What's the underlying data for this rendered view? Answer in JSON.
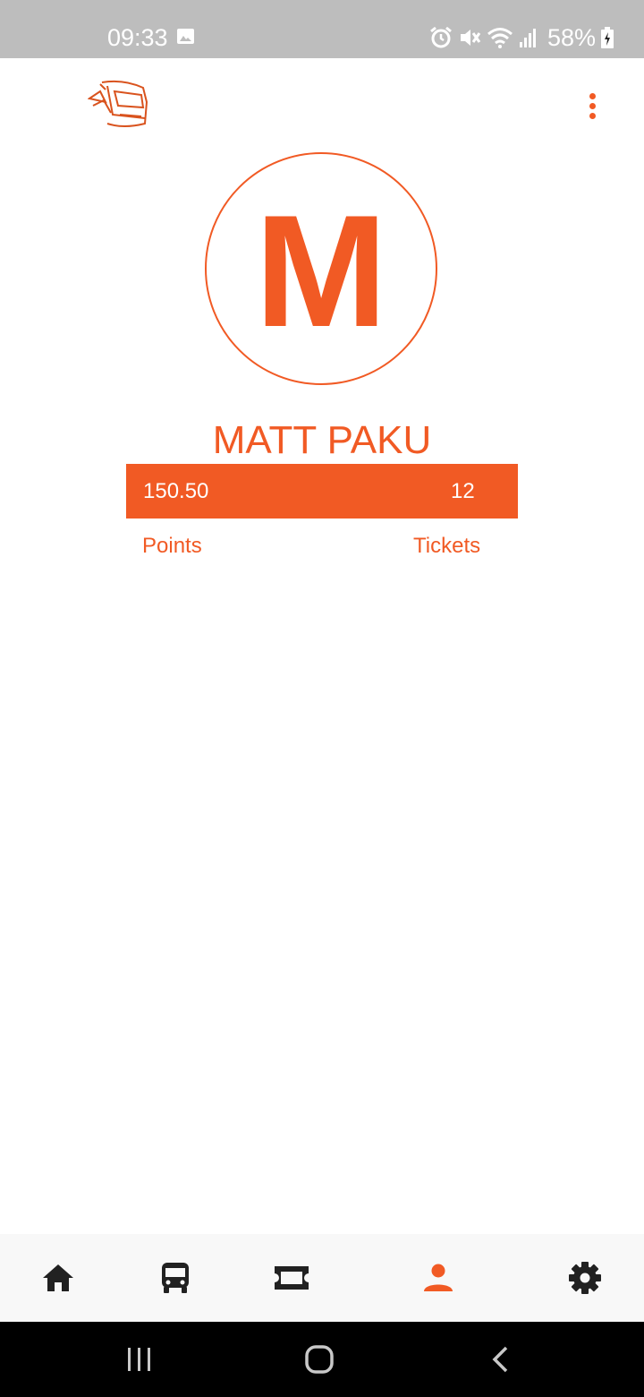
{
  "status_bar": {
    "time": "09:33",
    "battery_text": "58%",
    "icons": [
      "gallery-icon",
      "alarm-icon",
      "mute-icon",
      "wifi-icon",
      "signal-icon",
      "battery-icon"
    ]
  },
  "app_bar": {
    "logo_icon": "bus-logo-icon",
    "menu_icon": "more-vert-icon"
  },
  "profile": {
    "avatar_initial": "M",
    "name": "MATT PAKU",
    "points_value": "150.50",
    "tickets_value": "12",
    "points_label": "Points",
    "tickets_label": "Tickets"
  },
  "bottom_nav": {
    "items": [
      {
        "icon": "home-icon",
        "active": false
      },
      {
        "icon": "bus-icon",
        "active": false
      },
      {
        "icon": "ticket-icon",
        "active": false
      },
      {
        "icon": "person-icon",
        "active": true
      },
      {
        "icon": "settings-icon",
        "active": false
      }
    ]
  },
  "system_nav": {
    "icons": [
      "recents-icon",
      "home-circle-icon",
      "back-icon"
    ]
  },
  "colors": {
    "accent": "#f15a24",
    "status_bar_bg": "#bdbdbd",
    "nav_bg": "#f8f8f8",
    "icon_dark": "#212121",
    "system_nav_bg": "#000000"
  }
}
